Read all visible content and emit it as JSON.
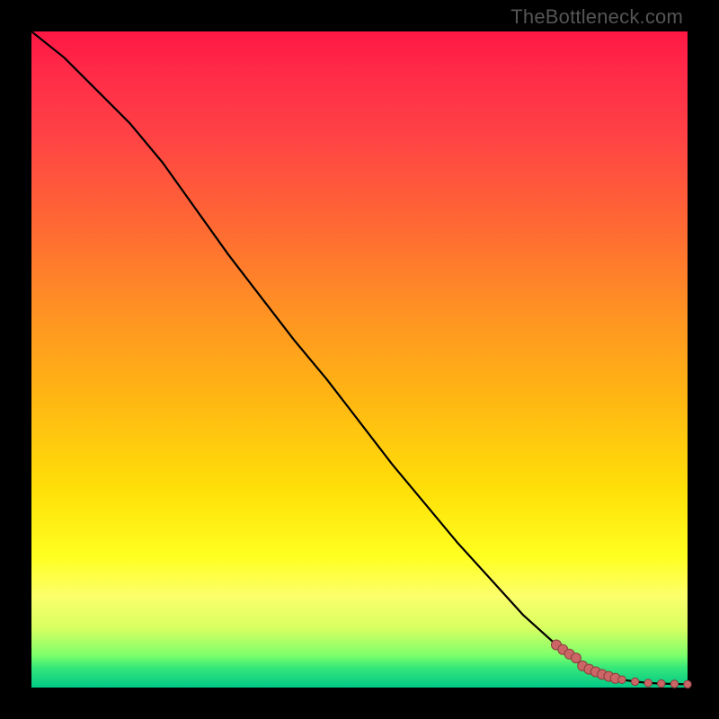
{
  "watermark": "TheBottleneck.com",
  "colors": {
    "background_frame": "#000000",
    "line": "#000000",
    "marker_fill": "#cc6666",
    "marker_stroke": "#8a3d3d",
    "gradient_top": "#ff1744",
    "gradient_mid": "#ffff20",
    "gradient_bottom": "#00c986"
  },
  "chart_data": {
    "type": "line",
    "title": "",
    "xlabel": "",
    "ylabel": "",
    "xlim": [
      0,
      100
    ],
    "ylim": [
      0,
      100
    ],
    "series": [
      {
        "name": "curve",
        "x": [
          0,
          5,
          10,
          15,
          20,
          25,
          30,
          35,
          40,
          45,
          50,
          55,
          60,
          65,
          70,
          75,
          80,
          84,
          86,
          88,
          90,
          92,
          94,
          96,
          98,
          100
        ],
        "y": [
          100,
          96,
          91,
          86,
          80,
          73,
          66,
          59.5,
          53,
          47,
          40.5,
          34,
          28,
          22,
          16.5,
          11,
          6.5,
          3.3,
          2.4,
          1.7,
          1.2,
          0.9,
          0.7,
          0.6,
          0.55,
          0.5
        ]
      },
      {
        "name": "markers",
        "x": [
          80,
          81,
          82,
          83,
          84,
          85,
          86,
          87,
          88,
          89,
          90,
          92,
          94,
          96,
          98,
          100
        ],
        "y": [
          6.5,
          5.8,
          5.1,
          4.5,
          3.3,
          2.8,
          2.4,
          2.0,
          1.7,
          1.4,
          1.2,
          0.9,
          0.7,
          0.6,
          0.55,
          0.5
        ]
      }
    ],
    "grid": false,
    "legend": false
  }
}
